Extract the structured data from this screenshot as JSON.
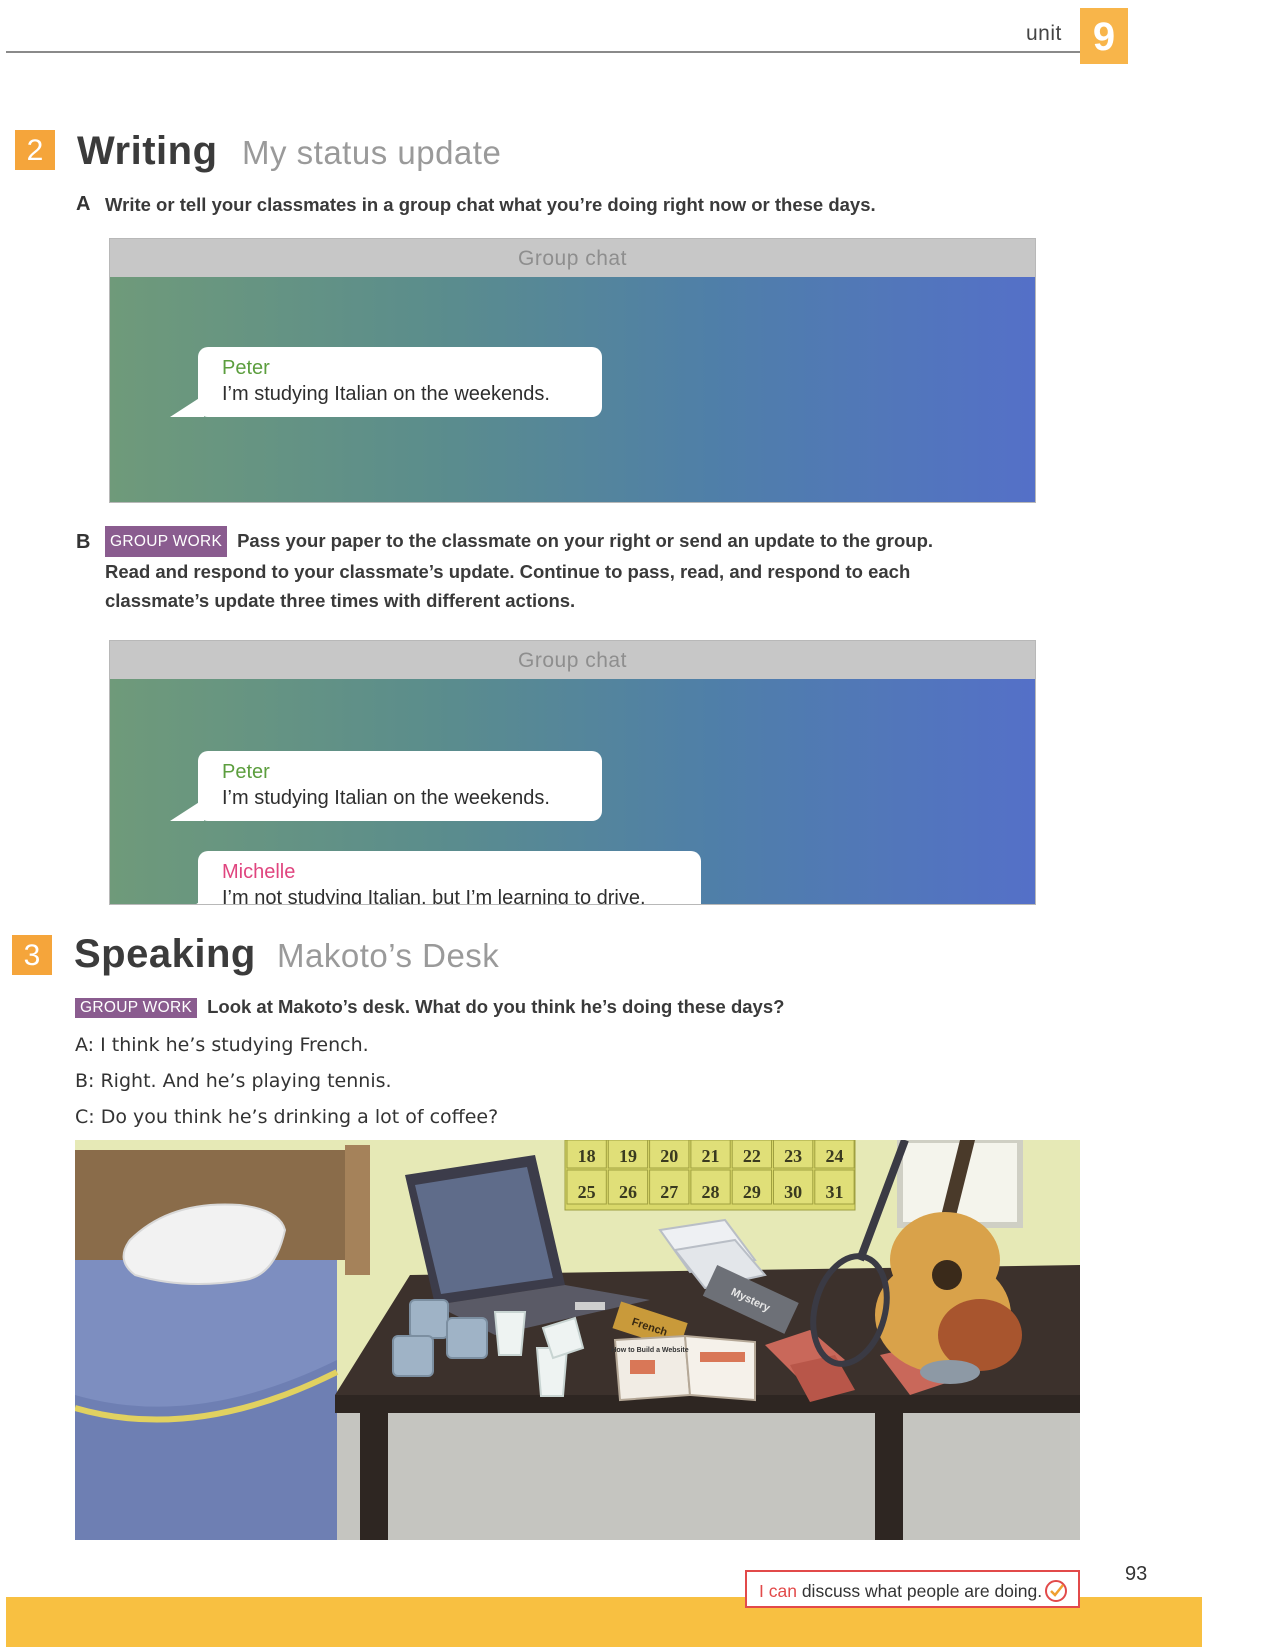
{
  "header": {
    "unit_label": "unit",
    "unit_number": "9"
  },
  "writing": {
    "number": "2",
    "title": "Writing",
    "subtitle": "My status update",
    "part_a": {
      "letter": "A",
      "instruction": "Write or tell your classmates in a group chat what you’re doing right now or these days."
    },
    "chat_a": {
      "title": "Group chat",
      "messages": [
        {
          "name": "Peter",
          "text": "I’m studying Italian on the weekends."
        }
      ]
    },
    "part_b": {
      "letter": "B",
      "badge": "GROUP WORK",
      "line1": "Pass your paper to the classmate on your right or send an update to the group.",
      "line2": "Read and respond to your classmate’s update. Continue to pass, read, and respond to each",
      "line3": "classmate’s update three times with different actions."
    },
    "chat_b": {
      "title": "Group chat",
      "messages": [
        {
          "name": "Peter",
          "text": "I’m studying Italian on the weekends."
        },
        {
          "name": "Michelle",
          "text": "I’m not studying Italian, but I’m learning to drive."
        }
      ]
    }
  },
  "speaking": {
    "number": "3",
    "title": "Speaking",
    "subtitle": "Makoto’s Desk",
    "badge": "GROUP WORK",
    "instruction": "Look at Makoto’s desk. What do you think he’s doing these days?",
    "dialogue": [
      {
        "speaker": "A:",
        "text": "I think he’s studying French."
      },
      {
        "speaker": "B:",
        "text": "Right. And he’s playing tennis."
      },
      {
        "speaker": "C:",
        "text": "Do you think he’s drinking a lot of coffee?"
      }
    ],
    "calendar": {
      "row1": [
        "18",
        "19",
        "20",
        "21",
        "22",
        "23",
        "24"
      ],
      "row2": [
        "25",
        "26",
        "27",
        "28",
        "29",
        "30",
        "31"
      ]
    },
    "book_french": "French",
    "book_mystery": "Mystery",
    "magazine_title": "How to Build a Website"
  },
  "footer": {
    "can_prefix": "I can",
    "can_text": "discuss what people are doing.",
    "page_number": "93"
  },
  "colors": {
    "section_orange": "#f5a53b",
    "badge_purple": "#8a5c8f",
    "peter_green": "#5c9e3e",
    "michelle_pink": "#e0457f",
    "footer_band": "#f8c041"
  }
}
